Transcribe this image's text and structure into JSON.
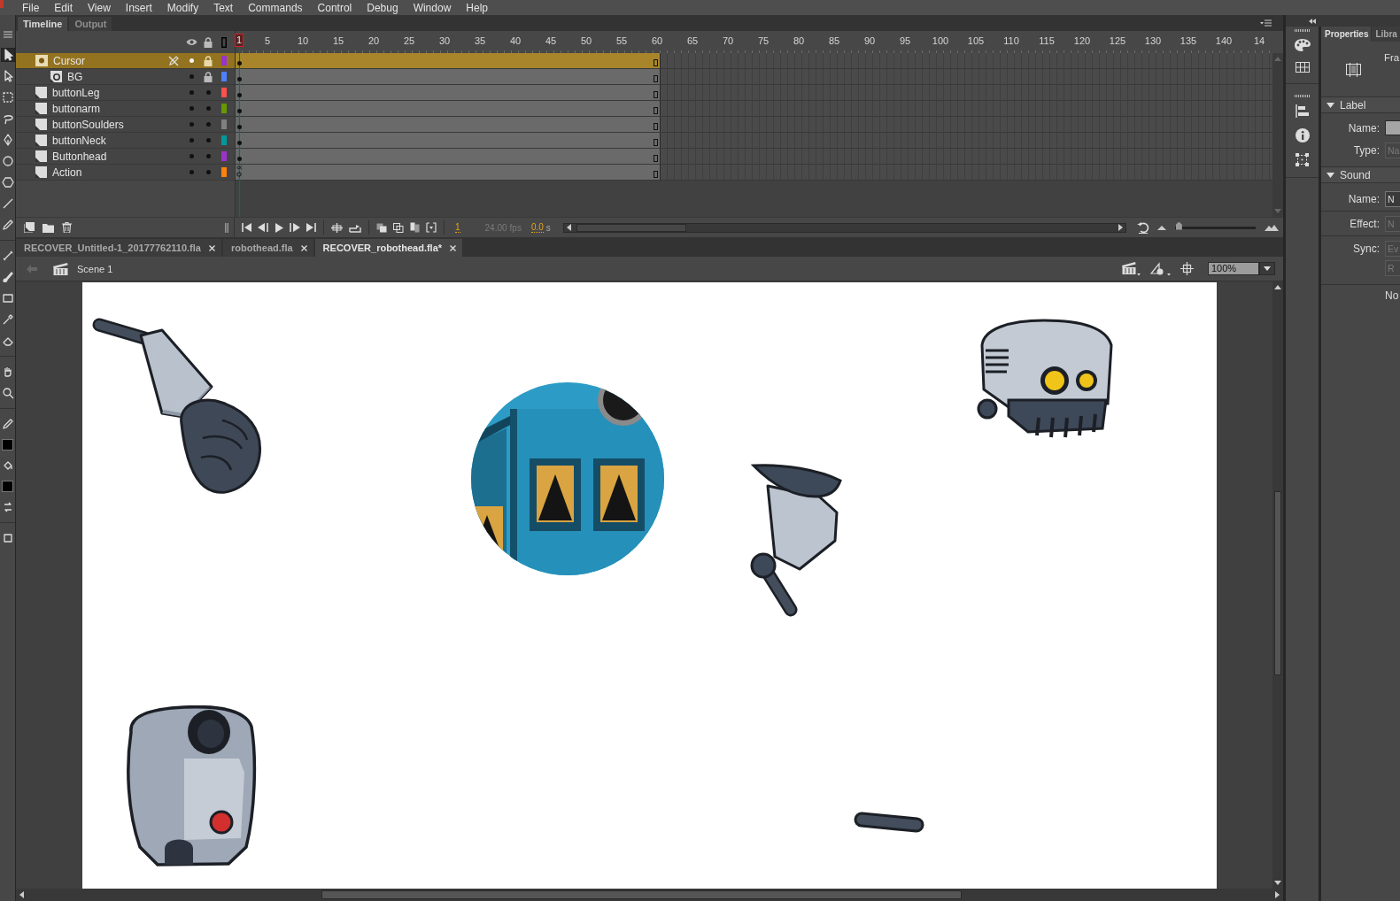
{
  "menu_bar": [
    "File",
    "Edit",
    "View",
    "Insert",
    "Modify",
    "Text",
    "Commands",
    "Control",
    "Debug",
    "Window",
    "Help"
  ],
  "timeline": {
    "tabs": [
      {
        "label": "Timeline",
        "selected": true
      },
      {
        "label": "Output",
        "selected": false
      }
    ],
    "ruler": [
      {
        "label": "1",
        "selected": true
      },
      {
        "label": "5",
        "selected": false
      },
      {
        "label": "10",
        "selected": false
      },
      {
        "label": "15",
        "selected": false
      },
      {
        "label": "20",
        "selected": false
      },
      {
        "label": "25",
        "selected": false
      },
      {
        "label": "30",
        "selected": false
      },
      {
        "label": "35",
        "selected": false
      },
      {
        "label": "40",
        "selected": false
      },
      {
        "label": "45",
        "selected": false
      },
      {
        "label": "50",
        "selected": false
      },
      {
        "label": "55",
        "selected": false
      },
      {
        "label": "60",
        "selected": false
      },
      {
        "label": "65",
        "selected": false
      },
      {
        "label": "70",
        "selected": false
      },
      {
        "label": "75",
        "selected": false
      },
      {
        "label": "80",
        "selected": false
      },
      {
        "label": "85",
        "selected": false
      },
      {
        "label": "90",
        "selected": false
      },
      {
        "label": "95",
        "selected": false
      },
      {
        "label": "100",
        "selected": false
      },
      {
        "label": "105",
        "selected": false
      },
      {
        "label": "110",
        "selected": false
      },
      {
        "label": "115",
        "selected": false
      },
      {
        "label": "120",
        "selected": false
      },
      {
        "label": "125",
        "selected": false
      },
      {
        "label": "130",
        "selected": false
      },
      {
        "label": "135",
        "selected": false
      },
      {
        "label": "140",
        "selected": false
      },
      {
        "label": "14",
        "selected": false
      }
    ],
    "layers": [
      {
        "name": "Cursor",
        "kind": "mask",
        "selected": true,
        "locked": true,
        "color": "#9933cc",
        "keyframe": {
          "kind": "filled"
        },
        "children": [
          {
            "name": "BG",
            "kind": "masked",
            "selected": false,
            "locked": true,
            "color": "#4f80ff",
            "keyframe": {
              "kind": "filled"
            }
          }
        ]
      },
      {
        "name": "buttonLeg",
        "kind": "normal",
        "selected": false,
        "locked": false,
        "color": "#ff4f4f",
        "keyframe": {
          "kind": "filled"
        }
      },
      {
        "name": "buttonarm",
        "kind": "normal",
        "selected": false,
        "locked": false,
        "color": "#669900",
        "keyframe": {
          "kind": "filled"
        }
      },
      {
        "name": "buttonSoulders",
        "kind": "normal",
        "selected": false,
        "locked": false,
        "color": "#808080",
        "keyframe": {
          "kind": "filled"
        }
      },
      {
        "name": "buttonNeck",
        "kind": "normal",
        "selected": false,
        "locked": false,
        "color": "#009999",
        "keyframe": {
          "kind": "filled"
        }
      },
      {
        "name": "Buttonhead",
        "kind": "normal",
        "selected": false,
        "locked": false,
        "color": "#9933cc",
        "keyframe": {
          "kind": "filled"
        }
      },
      {
        "name": "Action",
        "kind": "normal",
        "selected": false,
        "locked": false,
        "color": "#ff800a",
        "keyframe": {
          "kind": "action"
        }
      }
    ],
    "controls": {
      "frame": "1",
      "fps": "24.00",
      "fps_unit": "fps",
      "time": "0.0",
      "time_unit": "s"
    }
  },
  "document_tabs": [
    {
      "label": "RECOVER_Untitled-1_20177762110.fla",
      "selected": false
    },
    {
      "label": "robothead.fla",
      "selected": false
    },
    {
      "label": "RECOVER_robothead.fla*",
      "selected": true
    }
  ],
  "edit_bar": {
    "scene": "Scene 1",
    "zoom": "100%"
  },
  "properties": {
    "tabs": [
      {
        "label": "Properties",
        "selected": true
      },
      {
        "label": "Libra",
        "selected": false
      }
    ],
    "title": "Fra",
    "sections": [
      {
        "title": "Label",
        "expanded": true,
        "fields": [
          {
            "label": "Name:",
            "kind": "input",
            "disabled": false
          },
          {
            "label": "Type:",
            "kind": "dropdown",
            "value": "Na",
            "disabled": true
          }
        ]
      },
      {
        "title": "Sound",
        "expanded": true,
        "fields": [
          {
            "label": "Name:",
            "kind": "dropdown",
            "value": "N",
            "disabled": false
          },
          {
            "label": "Effect:",
            "kind": "dropdown",
            "value": "N",
            "disabled": true
          },
          {
            "label": "Sync:",
            "kind": "dropdown",
            "value": "Ev",
            "disabled": true
          },
          {
            "kind": "dropdown",
            "value": "R",
            "disabled": true
          }
        ],
        "note": "No"
      }
    ]
  }
}
